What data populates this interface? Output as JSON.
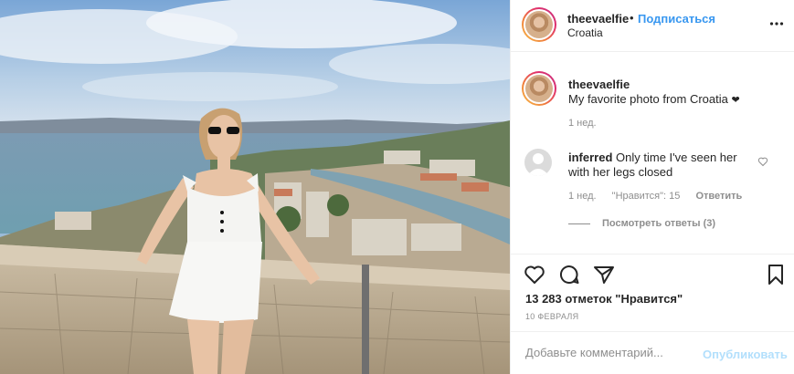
{
  "post": {
    "username": "theevaelfie",
    "separator": "•",
    "follow_label": "Подписаться",
    "location": "Croatia",
    "more_icon": "more-horizontal-icon"
  },
  "caption": {
    "username": "theevaelfie",
    "text": "My favorite photo from Croatia",
    "emoji": "❤",
    "time": "1 нед."
  },
  "comments": [
    {
      "username": "inferred",
      "text": "Only time I've seen her with her legs closed",
      "time": "1 нед.",
      "likes": "\"Нравится\": 15",
      "reply_label": "Ответить",
      "view_replies": "Посмотреть ответы (3)"
    }
  ],
  "actions": {
    "likes_count": "13 283 отметок \"Нравится\"",
    "date": "10 ФЕВРАЛЯ"
  },
  "comment_input": {
    "placeholder": "Добавьте комментарий...",
    "post_label": "Опубликовать"
  },
  "colors": {
    "link": "#3897f0",
    "muted": "#8e8e8e",
    "post_disabled": "#b2dffc"
  }
}
